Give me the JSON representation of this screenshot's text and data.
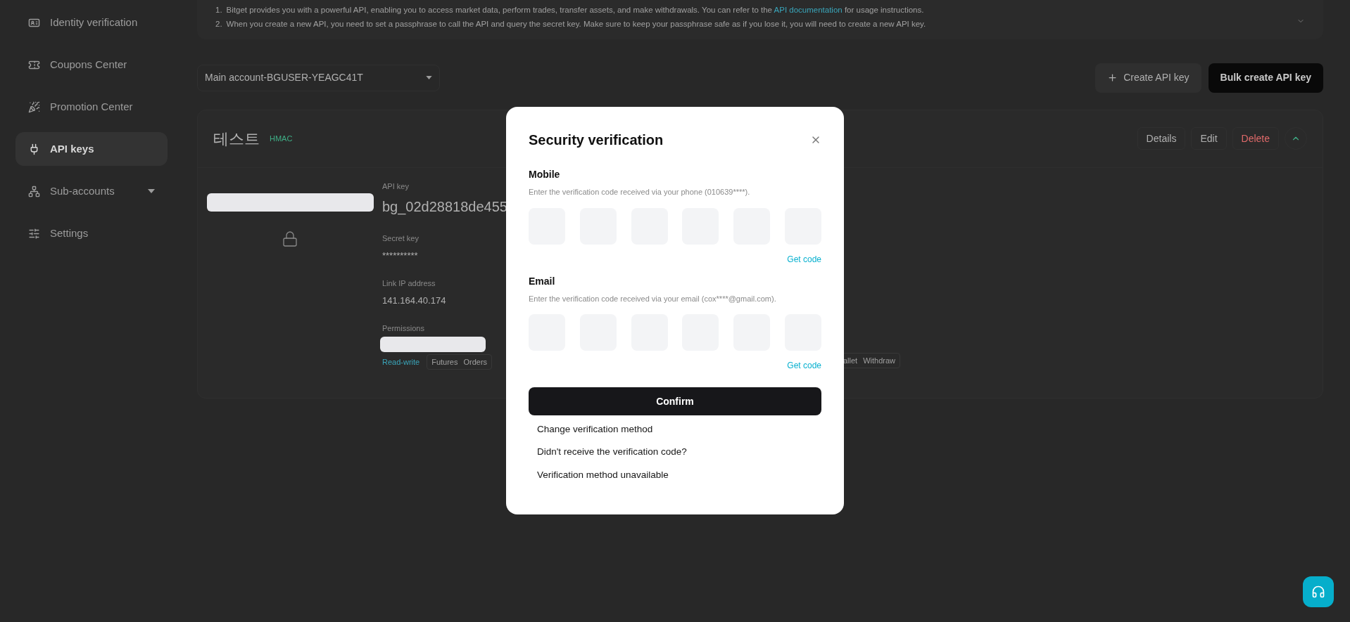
{
  "sidebar": {
    "items": [
      {
        "label": "Identity verification",
        "selected": false,
        "has_submenu": false
      },
      {
        "label": "Coupons Center",
        "selected": false,
        "has_submenu": false
      },
      {
        "label": "Promotion Center",
        "selected": false,
        "has_submenu": false
      },
      {
        "label": "API keys",
        "selected": true,
        "has_submenu": false
      },
      {
        "label": "Sub-accounts",
        "selected": false,
        "has_submenu": true
      },
      {
        "label": "Settings",
        "selected": false,
        "has_submenu": false
      }
    ]
  },
  "notice": {
    "items": [
      {
        "number": "1.",
        "text": "Bitget provides you with a powerful API, enabling you to access market data, perform trades, transfer assets, and make withdrawals. You can refer to the",
        "link": "API documentation",
        "text_after": "for usage instructions."
      },
      {
        "number": "2.",
        "text": "When you create a new API, you need to set a passphrase to call the API and query the secret key. Make sure to keep your passphrase safe as if you lose it, you will need to create a new API key."
      }
    ]
  },
  "account_select": {
    "value": "Main account-BGUSER-YEAGC41T"
  },
  "actions": [
    {
      "label": "Create API key",
      "kind": "outline"
    },
    {
      "label": "Bulk create API key",
      "kind": "primary"
    }
  ],
  "api_key_card": {
    "name": "테스트",
    "badge": "HMAC",
    "expanded": true,
    "buttons": [
      {
        "label": "Details",
        "kind": "default"
      },
      {
        "label": "Edit",
        "kind": "default"
      },
      {
        "label": "Delete",
        "kind": "danger"
      }
    ],
    "fields": [
      {
        "label": "API key",
        "value": "bg_02d28818de455",
        "kind": "large"
      },
      {
        "label": "Secret key",
        "value": "**********",
        "kind": "normal"
      },
      {
        "label": "Link IP address",
        "value": "141.164.40.174",
        "kind": "normal"
      }
    ],
    "permissions": {
      "label": "Permissions",
      "access": "Read-write",
      "scopes": [
        "Futures",
        "Orders"
      ],
      "scopes_right": [
        "allet",
        "Withdraw"
      ]
    }
  },
  "modal": {
    "title": "Security verification",
    "sections": [
      {
        "label": "Mobile",
        "hint": "Enter the verification code received via your phone (010639****).",
        "action": "Get code"
      },
      {
        "label": "Email",
        "hint": "Enter the verification code received via your email (cox****@gmail.com).",
        "action": "Get code"
      }
    ],
    "confirm": "Confirm",
    "links": [
      "Change verification method",
      "Didn't receive the verification code?",
      "Verification method unavailable"
    ]
  }
}
